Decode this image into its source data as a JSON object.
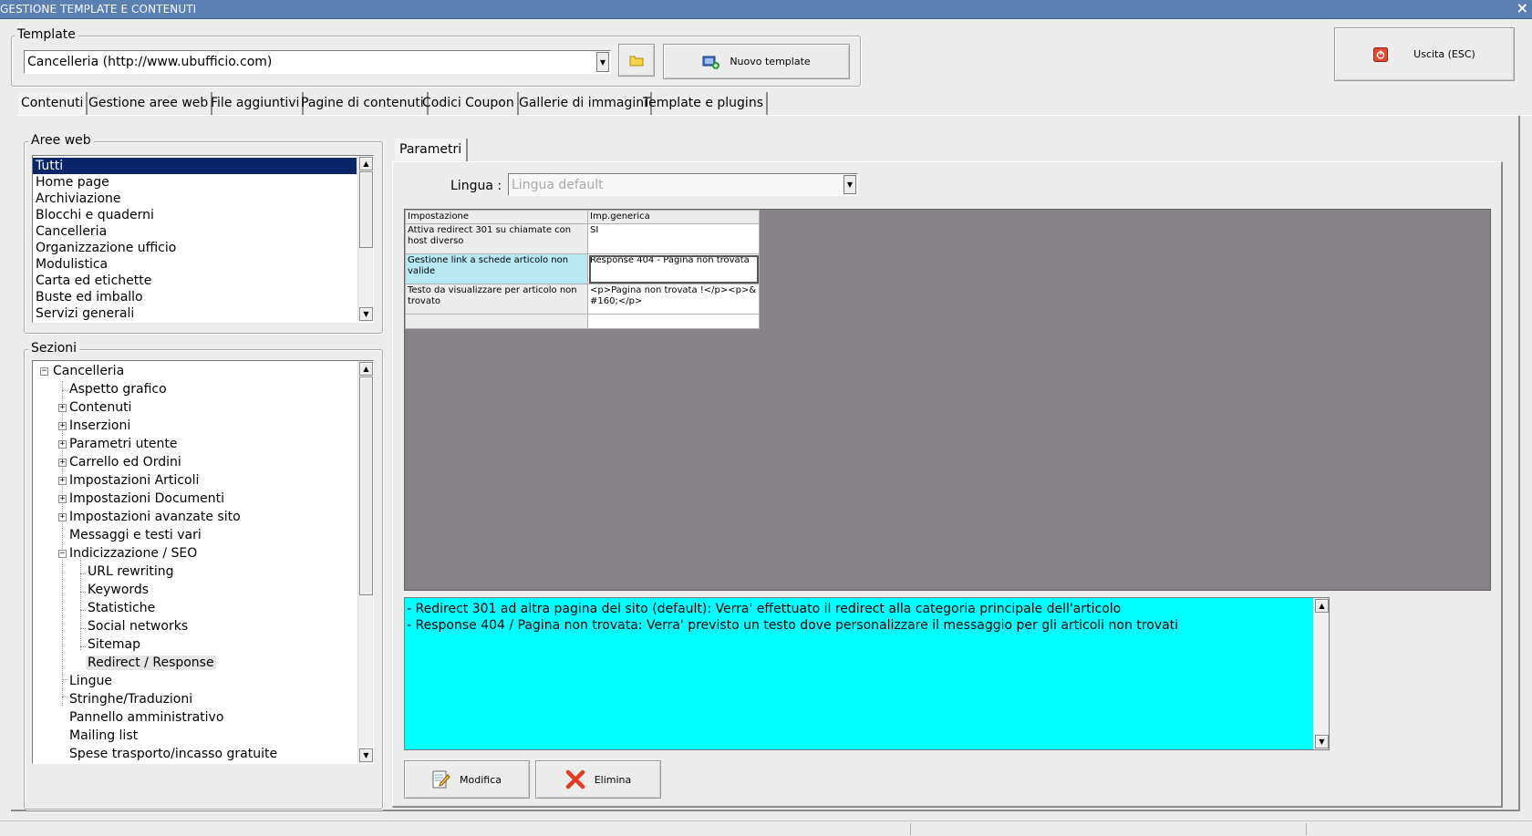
{
  "window": {
    "title": "GESTIONE TEMPLATE E CONTENUTI",
    "close_glyph": "×"
  },
  "template_group": {
    "caption": "Template",
    "selected": "Cancelleria (http://www.ubufficio.com)",
    "new_button": "Nuovo template"
  },
  "exit_button": "Uscita (ESC)",
  "tabs": [
    "Contenuti",
    "Gestione aree web",
    "File aggiuntivi",
    "Pagine di contenuti",
    "Codici Coupon",
    "Gallerie di immagini",
    "Template e plugins"
  ],
  "aree_web": {
    "caption": "Aree web",
    "items": [
      "Tutti",
      "Home page",
      "Archiviazione",
      "Blocchi e quaderni",
      "Cancelleria",
      "Organizzazione ufficio",
      "Modulistica",
      "Carta ed etichette",
      "Buste ed imballo",
      "Servizi generali"
    ],
    "selected_index": 0
  },
  "sezioni": {
    "caption": "Sezioni",
    "root": "Cancelleria",
    "children": [
      "Aspetto grafico",
      "Contenuti",
      "Inserzioni",
      "Parametri utente",
      "Carrello ed Ordini",
      "Impostazioni Articoli",
      "Impostazioni Documenti",
      "Impostazioni avanzate sito",
      "Messaggi e testi vari",
      "Indicizzazione / SEO"
    ],
    "seo_children": [
      "URL rewriting",
      "Keywords",
      "Statistiche",
      "Social networks",
      "Sitemap",
      "Redirect / Response"
    ],
    "after": [
      "Lingue",
      "Stringhe/Traduzioni",
      "Pannello amministrativo",
      "Mailing list",
      "Spese trasporto/incasso gratuite"
    ]
  },
  "parametri": {
    "tab": "Parametri",
    "lingua_label": "Lingua :",
    "lingua_value": "Lingua default",
    "grid": {
      "headers": [
        "Impostazione",
        "Imp.generica"
      ],
      "rows": [
        {
          "setting": "Attiva redirect 301 su chiamate con host diverso",
          "value": "SI"
        },
        {
          "setting": "Gestione link a schede articolo non valide",
          "value": "Response 404 - Pagina non trovata"
        },
        {
          "setting": "Testo da visualizzare per articolo non trovato",
          "value": "<p>Pagina non trovata !</p><p>&#160;</p>"
        }
      ]
    },
    "description": [
      "- Redirect 301 ad altra pagina del sito (default): Verra' effettuato il redirect alla categoria principale dell'articolo",
      "- Response 404 / Pagina non trovata: Verra' previsto un testo dove personalizzare il messaggio per gli articoli non trovati"
    ],
    "modifica_button": "Modifica",
    "elimina_button": "Elimina"
  },
  "colors": {
    "titlebar": "#5a7fb3",
    "selection": "#0a246a",
    "description_bg": "#00ffff",
    "grid_bg": "#858387"
  }
}
